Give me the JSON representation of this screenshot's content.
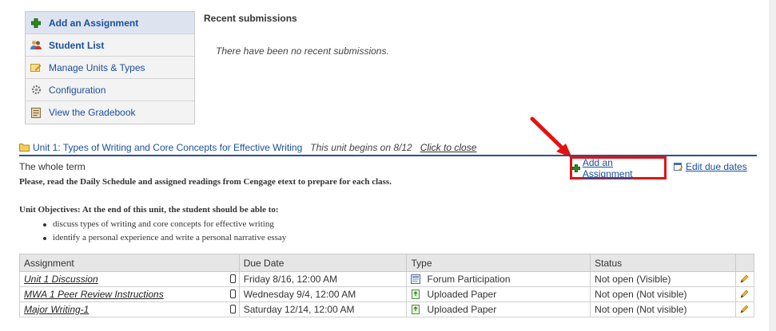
{
  "menu": {
    "items": [
      {
        "label": "Add an Assignment",
        "icon": "green-plus-icon"
      },
      {
        "label": "Student List",
        "icon": "users-icon"
      },
      {
        "label": "Manage Units & Types",
        "icon": "edit-note-icon"
      },
      {
        "label": "Configuration",
        "icon": "gear-icon"
      },
      {
        "label": "View the Gradebook",
        "icon": "gradebook-icon"
      }
    ]
  },
  "recent": {
    "title": "Recent submissions",
    "empty_text": "There have been no recent submissions."
  },
  "unit": {
    "title": "Unit 1: Types of Writing and Core Concepts for Effective Writing",
    "begins": "This unit begins on 8/12",
    "close": "Click to close",
    "term": "The whole term",
    "add_assignment": "Add an Assignment",
    "edit_due_dates": "Edit due dates",
    "instructions": "Please, read the Daily Schedule and assigned readings from Cengage etext to prepare for each class.",
    "objectives_title": "Unit Objectives: At the end of this unit, the student should be able to:",
    "objectives": [
      "discuss types of writing and core concepts for effective writing",
      "identify a personal experience and write a personal narrative essay"
    ]
  },
  "table": {
    "headers": [
      "Assignment",
      "Due Date",
      "Type",
      "Status",
      ""
    ],
    "rows": [
      {
        "name": "Unit 1 Discussion",
        "due": "Friday 8/16, 12:00 AM",
        "type": "Forum Participation",
        "status": "Not open (Visible)"
      },
      {
        "name": "MWA 1 Peer Review Instructions",
        "due": "Wednesday 9/4, 12:00 AM",
        "type": "Uploaded Paper",
        "status": "Not open (Not visible)"
      },
      {
        "name": "Major Writing-1",
        "due": "Saturday 12/14, 12:00 AM",
        "type": "Uploaded Paper",
        "status": "Not open (Not visible)"
      }
    ]
  },
  "colors": {
    "link": "#1b4f9c",
    "highlight_box": "#e31212",
    "unit_rule": "#2b4f91"
  }
}
